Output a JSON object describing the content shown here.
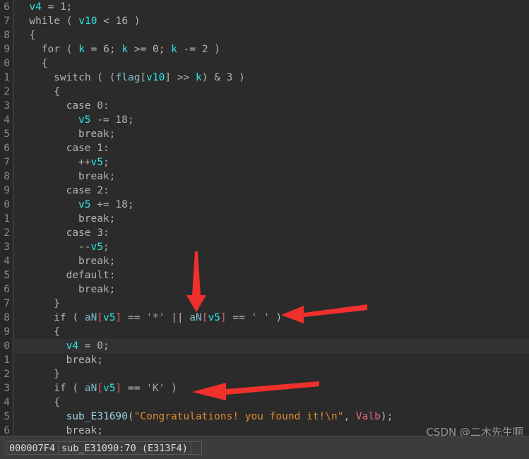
{
  "window": {
    "title": "IDA Pro pseudocode view",
    "background_color": "#2b2b2b",
    "gutter_color": "#292726",
    "highlight_row_color": "#323232"
  },
  "editor": {
    "lines": [
      {
        "num": "6",
        "indent": 2,
        "highlight": false,
        "tokens": [
          {
            "t": "v4",
            "c": "t-var"
          },
          {
            "t": " = ",
            "c": "t-punc"
          },
          {
            "t": "1",
            "c": "t-num"
          },
          {
            "t": ";",
            "c": "t-punc"
          }
        ]
      },
      {
        "num": "7",
        "indent": 2,
        "highlight": false,
        "tokens": [
          {
            "t": "while ( ",
            "c": "t-kw"
          },
          {
            "t": "v10",
            "c": "t-var"
          },
          {
            "t": " < ",
            "c": "t-punc"
          },
          {
            "t": "16",
            "c": "t-num"
          },
          {
            "t": " )",
            "c": "t-punc"
          }
        ]
      },
      {
        "num": "8",
        "indent": 2,
        "highlight": false,
        "tokens": [
          {
            "t": "{",
            "c": "t-punc"
          }
        ]
      },
      {
        "num": "9",
        "indent": 4,
        "highlight": false,
        "tokens": [
          {
            "t": "for ( ",
            "c": "t-kw"
          },
          {
            "t": "k",
            "c": "t-var"
          },
          {
            "t": " = ",
            "c": "t-punc"
          },
          {
            "t": "6",
            "c": "t-num"
          },
          {
            "t": "; ",
            "c": "t-punc"
          },
          {
            "t": "k",
            "c": "t-var"
          },
          {
            "t": " >= ",
            "c": "t-punc"
          },
          {
            "t": "0",
            "c": "t-num"
          },
          {
            "t": "; ",
            "c": "t-punc"
          },
          {
            "t": "k",
            "c": "t-var"
          },
          {
            "t": " -= ",
            "c": "t-punc"
          },
          {
            "t": "2",
            "c": "t-num"
          },
          {
            "t": " )",
            "c": "t-punc"
          }
        ]
      },
      {
        "num": "0",
        "indent": 4,
        "highlight": false,
        "tokens": [
          {
            "t": "{",
            "c": "t-punc"
          }
        ]
      },
      {
        "num": "1",
        "indent": 6,
        "highlight": false,
        "tokens": [
          {
            "t": "switch ( (",
            "c": "t-kw"
          },
          {
            "t": "flag",
            "c": "t-arr"
          },
          {
            "t": "[",
            "c": "t-punc"
          },
          {
            "t": "v10",
            "c": "t-var"
          },
          {
            "t": "]",
            "c": "t-punc"
          },
          {
            "t": " >> ",
            "c": "t-punc"
          },
          {
            "t": "k",
            "c": "t-var"
          },
          {
            "t": ") & ",
            "c": "t-punc"
          },
          {
            "t": "3",
            "c": "t-num"
          },
          {
            "t": " )",
            "c": "t-punc"
          }
        ]
      },
      {
        "num": "2",
        "indent": 6,
        "highlight": false,
        "tokens": [
          {
            "t": "{",
            "c": "t-punc"
          }
        ]
      },
      {
        "num": "3",
        "indent": 8,
        "highlight": false,
        "tokens": [
          {
            "t": "case ",
            "c": "t-kw"
          },
          {
            "t": "0",
            "c": "t-num"
          },
          {
            "t": ":",
            "c": "t-punc"
          }
        ]
      },
      {
        "num": "4",
        "indent": 10,
        "highlight": false,
        "tokens": [
          {
            "t": "v5",
            "c": "t-var"
          },
          {
            "t": " -= ",
            "c": "t-punc"
          },
          {
            "t": "18",
            "c": "t-num"
          },
          {
            "t": ";",
            "c": "t-punc"
          }
        ]
      },
      {
        "num": "5",
        "indent": 10,
        "highlight": false,
        "tokens": [
          {
            "t": "break;",
            "c": "t-kw"
          }
        ]
      },
      {
        "num": "6",
        "indent": 8,
        "highlight": false,
        "tokens": [
          {
            "t": "case ",
            "c": "t-kw"
          },
          {
            "t": "1",
            "c": "t-num"
          },
          {
            "t": ":",
            "c": "t-punc"
          }
        ]
      },
      {
        "num": "7",
        "indent": 10,
        "highlight": false,
        "tokens": [
          {
            "t": "++",
            "c": "t-punc"
          },
          {
            "t": "v5",
            "c": "t-var"
          },
          {
            "t": ";",
            "c": "t-punc"
          }
        ]
      },
      {
        "num": "8",
        "indent": 10,
        "highlight": false,
        "tokens": [
          {
            "t": "break;",
            "c": "t-kw"
          }
        ]
      },
      {
        "num": "9",
        "indent": 8,
        "highlight": false,
        "tokens": [
          {
            "t": "case ",
            "c": "t-kw"
          },
          {
            "t": "2",
            "c": "t-num"
          },
          {
            "t": ":",
            "c": "t-punc"
          }
        ]
      },
      {
        "num": "0",
        "indent": 10,
        "highlight": false,
        "tokens": [
          {
            "t": "v5",
            "c": "t-var"
          },
          {
            "t": " += ",
            "c": "t-punc"
          },
          {
            "t": "18",
            "c": "t-num"
          },
          {
            "t": ";",
            "c": "t-punc"
          }
        ]
      },
      {
        "num": "1",
        "indent": 10,
        "highlight": false,
        "tokens": [
          {
            "t": "break;",
            "c": "t-kw"
          }
        ]
      },
      {
        "num": "2",
        "indent": 8,
        "highlight": false,
        "tokens": [
          {
            "t": "case ",
            "c": "t-kw"
          },
          {
            "t": "3",
            "c": "t-num"
          },
          {
            "t": ":",
            "c": "t-punc"
          }
        ]
      },
      {
        "num": "3",
        "indent": 10,
        "highlight": false,
        "tokens": [
          {
            "t": "--",
            "c": "t-punc"
          },
          {
            "t": "v5",
            "c": "t-var"
          },
          {
            "t": ";",
            "c": "t-punc"
          }
        ]
      },
      {
        "num": "4",
        "indent": 10,
        "highlight": false,
        "tokens": [
          {
            "t": "break;",
            "c": "t-kw"
          }
        ]
      },
      {
        "num": "5",
        "indent": 8,
        "highlight": false,
        "tokens": [
          {
            "t": "default:",
            "c": "t-kw"
          }
        ]
      },
      {
        "num": "6",
        "indent": 10,
        "highlight": false,
        "tokens": [
          {
            "t": "break;",
            "c": "t-kw"
          }
        ]
      },
      {
        "num": "7",
        "indent": 6,
        "highlight": false,
        "tokens": [
          {
            "t": "}",
            "c": "t-punc"
          }
        ]
      },
      {
        "num": "8",
        "indent": 6,
        "highlight": false,
        "tokens": [
          {
            "t": "if ( ",
            "c": "t-kw"
          },
          {
            "t": "aN",
            "c": "t-arr"
          },
          {
            "t": "[",
            "c": "t-brk"
          },
          {
            "t": "v5",
            "c": "t-var"
          },
          {
            "t": "]",
            "c": "t-brk"
          },
          {
            "t": " == ",
            "c": "t-punc"
          },
          {
            "t": "'*'",
            "c": "t-chr"
          },
          {
            "t": " || ",
            "c": "t-punc"
          },
          {
            "t": "aN",
            "c": "t-arr"
          },
          {
            "t": "[",
            "c": "t-brk"
          },
          {
            "t": "v5",
            "c": "t-var"
          },
          {
            "t": "]",
            "c": "t-brk"
          },
          {
            "t": " == ",
            "c": "t-punc"
          },
          {
            "t": "' '",
            "c": "t-chr"
          },
          {
            "t": " )",
            "c": "t-punc"
          }
        ]
      },
      {
        "num": "9",
        "indent": 6,
        "highlight": false,
        "tokens": [
          {
            "t": "{",
            "c": "t-punc"
          }
        ]
      },
      {
        "num": "0",
        "indent": 8,
        "highlight": true,
        "tokens": [
          {
            "t": "v4",
            "c": "t-var"
          },
          {
            "t": " = ",
            "c": "t-punc"
          },
          {
            "t": "0",
            "c": "t-num"
          },
          {
            "t": ";",
            "c": "t-punc"
          }
        ]
      },
      {
        "num": "1",
        "indent": 8,
        "highlight": false,
        "tokens": [
          {
            "t": "break;",
            "c": "t-kw"
          }
        ]
      },
      {
        "num": "2",
        "indent": 6,
        "highlight": false,
        "tokens": [
          {
            "t": "}",
            "c": "t-punc"
          }
        ]
      },
      {
        "num": "3",
        "indent": 6,
        "highlight": false,
        "tokens": [
          {
            "t": "if ( ",
            "c": "t-kw"
          },
          {
            "t": "aN",
            "c": "t-arr"
          },
          {
            "t": "[",
            "c": "t-brk"
          },
          {
            "t": "v5",
            "c": "t-var"
          },
          {
            "t": "]",
            "c": "t-brk"
          },
          {
            "t": " == ",
            "c": "t-punc"
          },
          {
            "t": "'K'",
            "c": "t-chr"
          },
          {
            "t": " )",
            "c": "t-punc"
          }
        ]
      },
      {
        "num": "4",
        "indent": 6,
        "highlight": false,
        "tokens": [
          {
            "t": "{",
            "c": "t-punc"
          }
        ]
      },
      {
        "num": "5",
        "indent": 8,
        "highlight": false,
        "tokens": [
          {
            "t": "sub_E31690",
            "c": "t-call"
          },
          {
            "t": "(",
            "c": "t-punc"
          },
          {
            "t": "\"Congratulations! you found it!\\n\"",
            "c": "t-str"
          },
          {
            "t": ", ",
            "c": "t-punc"
          },
          {
            "t": "Valb",
            "c": "t-arg"
          },
          {
            "t": ");",
            "c": "t-punc"
          }
        ]
      },
      {
        "num": "6",
        "indent": 8,
        "highlight": false,
        "tokens": [
          {
            "t": "break;",
            "c": "t-kw"
          }
        ]
      }
    ]
  },
  "annotations": {
    "color": "#f0302c",
    "arrows": [
      {
        "name": "down-arrow-to-aN-v5-star",
        "direction": "down"
      },
      {
        "name": "right-to-left-arrow-if-star-or-space",
        "direction": "left"
      },
      {
        "name": "right-to-left-arrow-if-k",
        "direction": "left"
      }
    ]
  },
  "watermark": {
    "text": "CSDN @二木先生啊"
  },
  "status_bar": {
    "offset": "000007F4",
    "location": "sub_E31090:70 (E313F4)"
  }
}
